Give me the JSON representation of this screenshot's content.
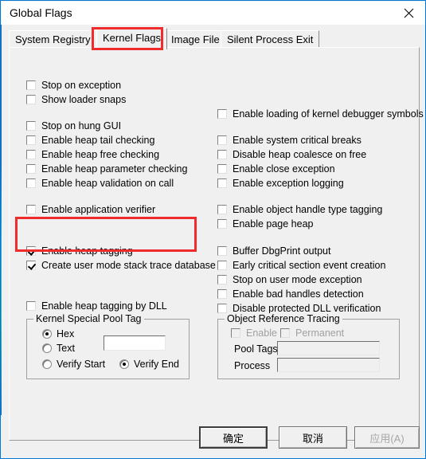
{
  "window": {
    "title": "Global Flags",
    "close_icon": "close-icon"
  },
  "tabs": [
    {
      "label": "System Registry",
      "selected": false
    },
    {
      "label": "Kernel Flags",
      "selected": true
    },
    {
      "label": "Image File",
      "selected": false
    },
    {
      "label": "Silent Process Exit",
      "selected": false
    }
  ],
  "left_column": [
    {
      "label": "Stop on exception",
      "checked": false
    },
    {
      "label": "Show loader snaps",
      "checked": false
    },
    {
      "label": "Stop on hung GUI",
      "checked": false
    },
    {
      "label": "Enable heap tail checking",
      "checked": false
    },
    {
      "label": "Enable heap free checking",
      "checked": false
    },
    {
      "label": "Enable heap parameter checking",
      "checked": false
    },
    {
      "label": "Enable heap validation on call",
      "checked": false
    },
    {
      "label": "Enable application verifier",
      "checked": false
    },
    {
      "label": "Enable heap tagging",
      "checked": true
    },
    {
      "label": "Create user mode stack trace database",
      "checked": true
    },
    {
      "label": "Enable heap tagging by DLL",
      "checked": false
    }
  ],
  "right_column": [
    {
      "label": "Enable loading of kernel debugger symbols",
      "checked": false
    },
    {
      "label": "Enable system critical breaks",
      "checked": false
    },
    {
      "label": "Disable heap coalesce on free",
      "checked": false
    },
    {
      "label": "Enable close exception",
      "checked": false
    },
    {
      "label": "Enable exception logging",
      "checked": false
    },
    {
      "label": "Enable object handle type tagging",
      "checked": false
    },
    {
      "label": "Enable page heap",
      "checked": false
    },
    {
      "label": "Buffer DbgPrint output",
      "checked": false
    },
    {
      "label": "Early critical section event creation",
      "checked": false
    },
    {
      "label": "Stop on user mode exception",
      "checked": false
    },
    {
      "label": "Enable bad handles detection",
      "checked": false
    },
    {
      "label": "Disable protected DLL verification",
      "checked": false
    }
  ],
  "pool_tag_group": {
    "title": "Kernel Special Pool Tag",
    "hex_label": "Hex",
    "text_label": "Text",
    "verify_start_label": "Verify Start",
    "verify_end_label": "Verify End",
    "hex_selected": true,
    "text_selected": false,
    "verify_start_selected": false,
    "verify_end_selected": true,
    "tag_value": "",
    "tag_placeholder": ""
  },
  "object_tracing_group": {
    "title": "Object Reference Tracing",
    "enable_label": "Enable",
    "permanent_label": "Permanent",
    "enable_checked": false,
    "permanent_checked": false,
    "pool_tags_label": "Pool Tags",
    "process_label": "Process",
    "pool_tags_value": "",
    "process_value": "",
    "disabled": true
  },
  "buttons": {
    "ok": "确定",
    "cancel": "取消",
    "apply": "应用(A)"
  },
  "annotations": {
    "tab_highlight_color": "#ef2b2b",
    "checkbox_highlight_color": "#ef2b2b"
  }
}
